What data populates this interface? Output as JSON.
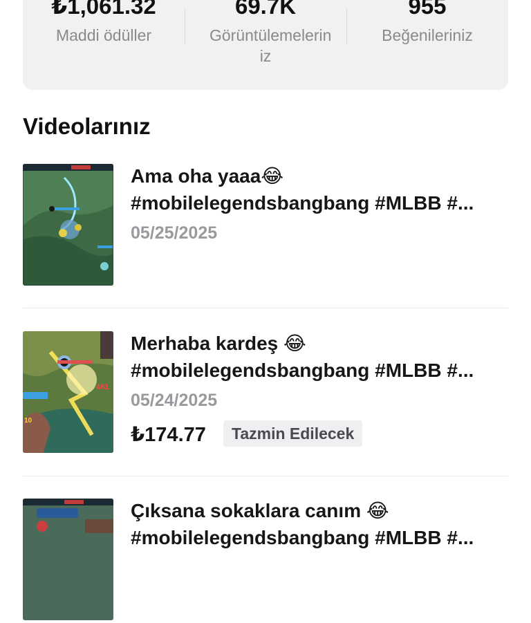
{
  "stats": [
    {
      "value": "₺1,061.32",
      "label": "Maddi ödüller"
    },
    {
      "value": "69.7K",
      "label": "Görüntülemelerin iz"
    },
    {
      "value": "955",
      "label": "Beğenileriniz"
    }
  ],
  "section_title": "Videolarınız",
  "videos": [
    {
      "title_line1": "Ama oha yaaa😂",
      "title_line2": "#mobilelegendsbangbang #MLBB #...",
      "date": "05/25/2025"
    },
    {
      "title_line1": "Merhaba kardeş 😂",
      "title_line2": "#mobilelegendsbangbang #MLBB #...",
      "date": "05/24/2025",
      "amount": "₺174.77",
      "badge": "Tazmin Edilecek"
    },
    {
      "title_line1": "Çıksana sokaklara canım 😂",
      "title_line2": "#mobilelegendsbangbang #MLBB #..."
    }
  ]
}
